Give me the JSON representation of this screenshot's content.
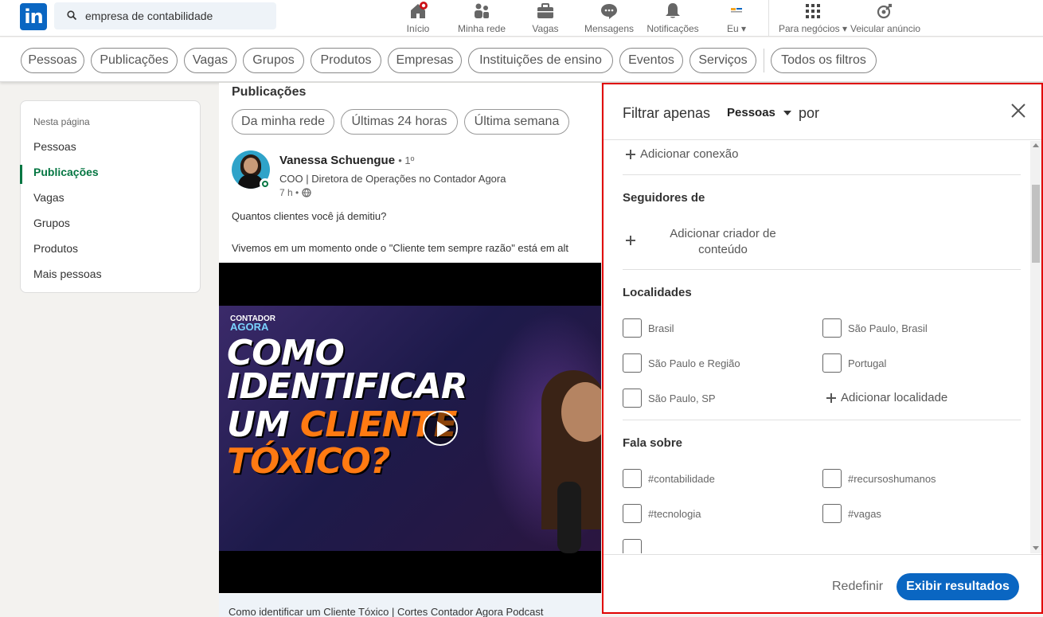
{
  "topnav": {
    "logo_text": "in",
    "search_value": "empresa de contabilidade",
    "items": [
      {
        "label": "Início",
        "icon": "home-icon"
      },
      {
        "label": "Minha rede",
        "icon": "network-icon"
      },
      {
        "label": "Vagas",
        "icon": "briefcase-icon"
      },
      {
        "label": "Mensagens",
        "icon": "messaging-icon"
      },
      {
        "label": "Notificações",
        "icon": "bell-icon"
      },
      {
        "label": "Eu",
        "icon": "avatar-icon"
      },
      {
        "label": "Para negócios",
        "icon": "grid-icon"
      },
      {
        "label": "Veicular anúncio",
        "icon": "advertise-icon"
      }
    ],
    "accent": "#0a66c2"
  },
  "filterbar": {
    "pills": [
      "Pessoas",
      "Publicações",
      "Vagas",
      "Grupos",
      "Produtos",
      "Empresas",
      "Instituições de ensino",
      "Eventos",
      "Serviços"
    ],
    "all_filters": "Todos os filtros"
  },
  "leftnav": {
    "heading": "Nesta página",
    "items": [
      "Pessoas",
      "Publicações",
      "Vagas",
      "Grupos",
      "Produtos",
      "Mais pessoas"
    ],
    "active": "Publicações",
    "active_color": "#057642"
  },
  "feed": {
    "title": "Publicações",
    "quick_filters": [
      "Da minha rede",
      "Últimas 24 horas",
      "Última semana"
    ],
    "post": {
      "author": "Vanessa Schuengue",
      "degree": "• 1º",
      "subtitle": "COO | Diretora de Operações no Contador Agora",
      "time": "7 h •",
      "question": "Quantos clientes você já demitiu?",
      "body": "Vivemos em um momento onde o \"Cliente tem sempre razão\" está em alt",
      "video": {
        "logo_line1": "CONTADOR",
        "logo_line2": "AGORA",
        "line1": "COMO",
        "line2": "IDENTIFICAR",
        "line3a": "UM ",
        "line3b": "CLIENTE",
        "line4": "TÓXICO?"
      },
      "caption": "Como identificar um Cliente Tóxico | Cortes Contador Agora Podcast"
    }
  },
  "panel": {
    "label": "Filtrar apenas",
    "selected_type": "Pessoas",
    "por": "por",
    "add_connection": "Adicionar conexão",
    "followers_heading": "Seguidores de",
    "add_creator": "Adicionar criador de conteúdo",
    "locations_heading": "Localidades",
    "locations": [
      "Brasil",
      "São Paulo, Brasil",
      "São Paulo e Região",
      "Portugal",
      "São Paulo, SP"
    ],
    "add_location": "Adicionar localidade",
    "talks_heading": "Fala sobre",
    "topics": [
      "#contabilidade",
      "#recursoshumanos",
      "#tecnologia",
      "#vagas"
    ],
    "reset_label": "Redefinir",
    "show_label": "Exibir resultados",
    "highlight_color": "#e00000"
  }
}
